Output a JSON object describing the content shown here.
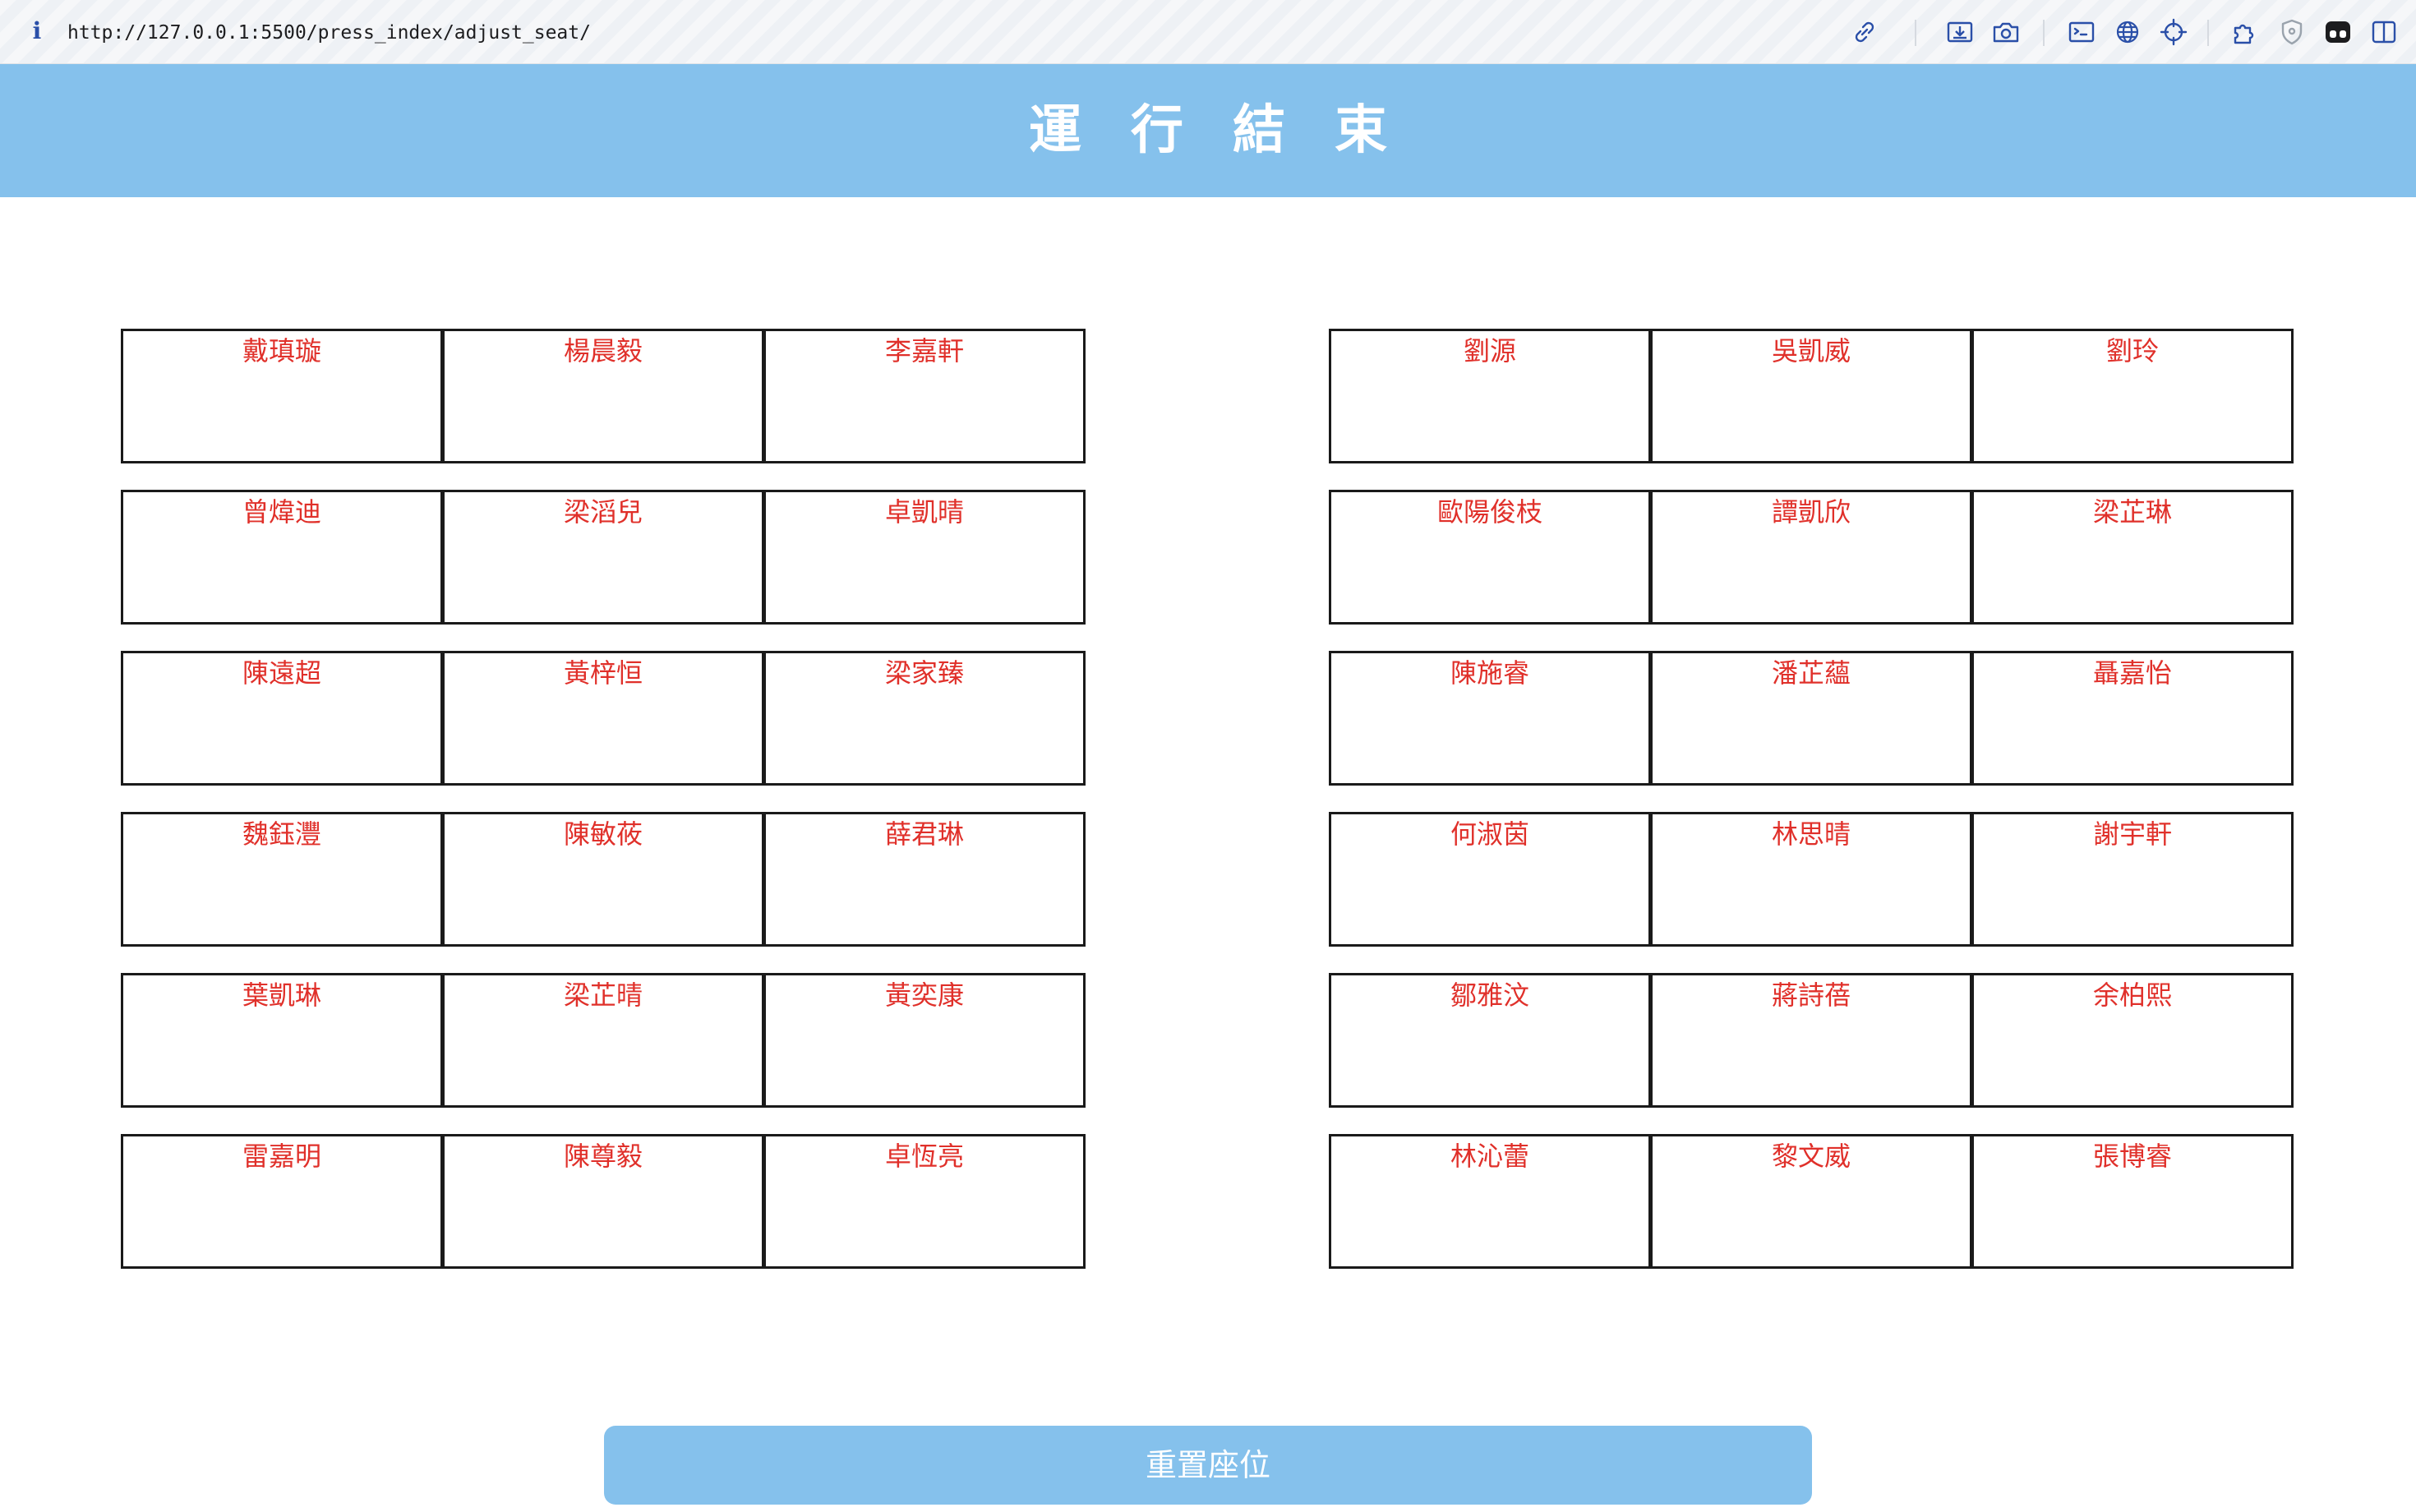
{
  "browser": {
    "url": "http://127.0.0.1:5500/press_index/adjust_seat/",
    "info_glyph": "i",
    "toolbar_icons": [
      "link-icon",
      "download-icon",
      "camera-icon",
      "terminal-icon",
      "globe-icon",
      "crosshair-icon",
      "puzzle-icon",
      "shield-icon",
      "extension-icon",
      "sidebar-icon"
    ]
  },
  "header": {
    "title": "運行結束",
    "background": "#85c1ec"
  },
  "seats": {
    "name_color": "#e0302a",
    "left": [
      [
        "戴瑱璇",
        "楊晨毅",
        "李嘉軒"
      ],
      [
        "曾煒迪",
        "梁滔兒",
        "卓凱晴"
      ],
      [
        "陳遠超",
        "黃梓恒",
        "梁家臻"
      ],
      [
        "魏鈺灃",
        "陳敏莜",
        "薛君琳"
      ],
      [
        "葉凱琳",
        "梁芷晴",
        "黃奕康"
      ],
      [
        "雷嘉明",
        "陳尊毅",
        "卓恆亮"
      ]
    ],
    "right": [
      [
        "劉源",
        "吳凱威",
        "劉玲"
      ],
      [
        "歐陽俊枝",
        "譚凱欣",
        "梁芷琳"
      ],
      [
        "陳施睿",
        "潘芷蘊",
        "聶嘉怡"
      ],
      [
        "何淑茵",
        "林思晴",
        "謝宇軒"
      ],
      [
        "鄒雅汶",
        "蔣詩蓓",
        "余柏熙"
      ],
      [
        "林沁蕾",
        "黎文威",
        "張博睿"
      ]
    ]
  },
  "reset_button": {
    "label": "重置座位"
  }
}
